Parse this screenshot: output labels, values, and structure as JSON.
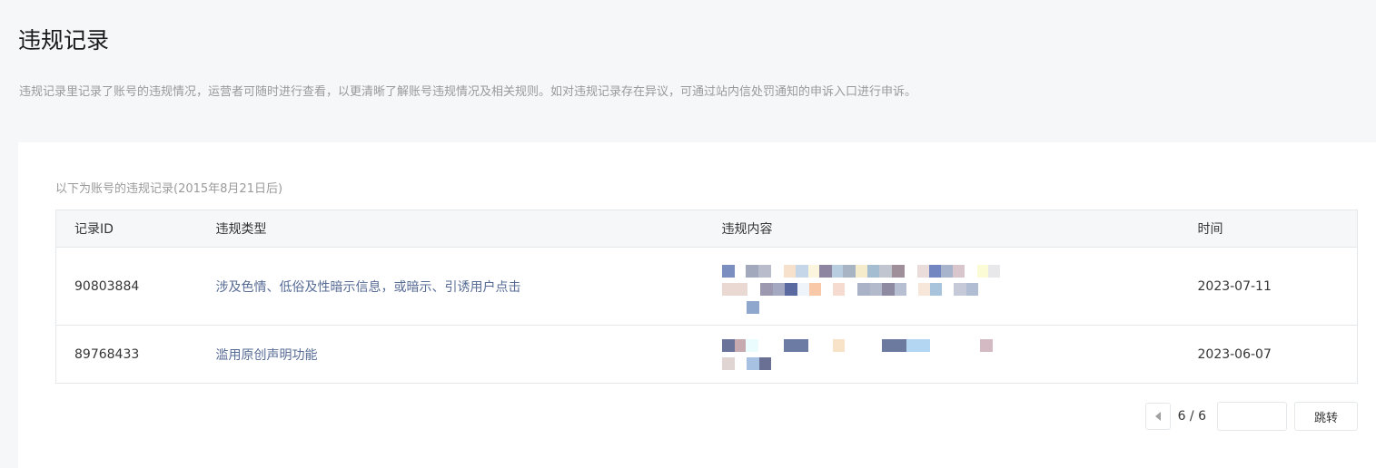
{
  "page": {
    "title": "违规记录",
    "description": "违规记录里记录了账号的违规情况，运营者可随时进行查看，以更清晰了解账号违规情况及相关规则。如对违规记录存在异议，可通过站内信处罚通知的申诉入口进行申诉。"
  },
  "records": {
    "intro": "以下为账号的违规记录(2015年8月21日后)",
    "columns": {
      "id": "记录ID",
      "type": "违规类型",
      "content": "违规内容",
      "time": "时间"
    },
    "rows": [
      {
        "id": "90803884",
        "type": "涉及色情、低俗及性暗示信息，或暗示、引诱用户点击",
        "time": "2023-07-11"
      },
      {
        "id": "89768433",
        "type": "滥用原创声明功能",
        "time": "2023-06-07"
      }
    ]
  },
  "pagination": {
    "current": "6 / 6",
    "input_value": "",
    "jump_label": "跳转"
  },
  "colors": {
    "link": "#576b95",
    "border": "#e4e8eb",
    "header_bg": "#f6f7f9"
  }
}
